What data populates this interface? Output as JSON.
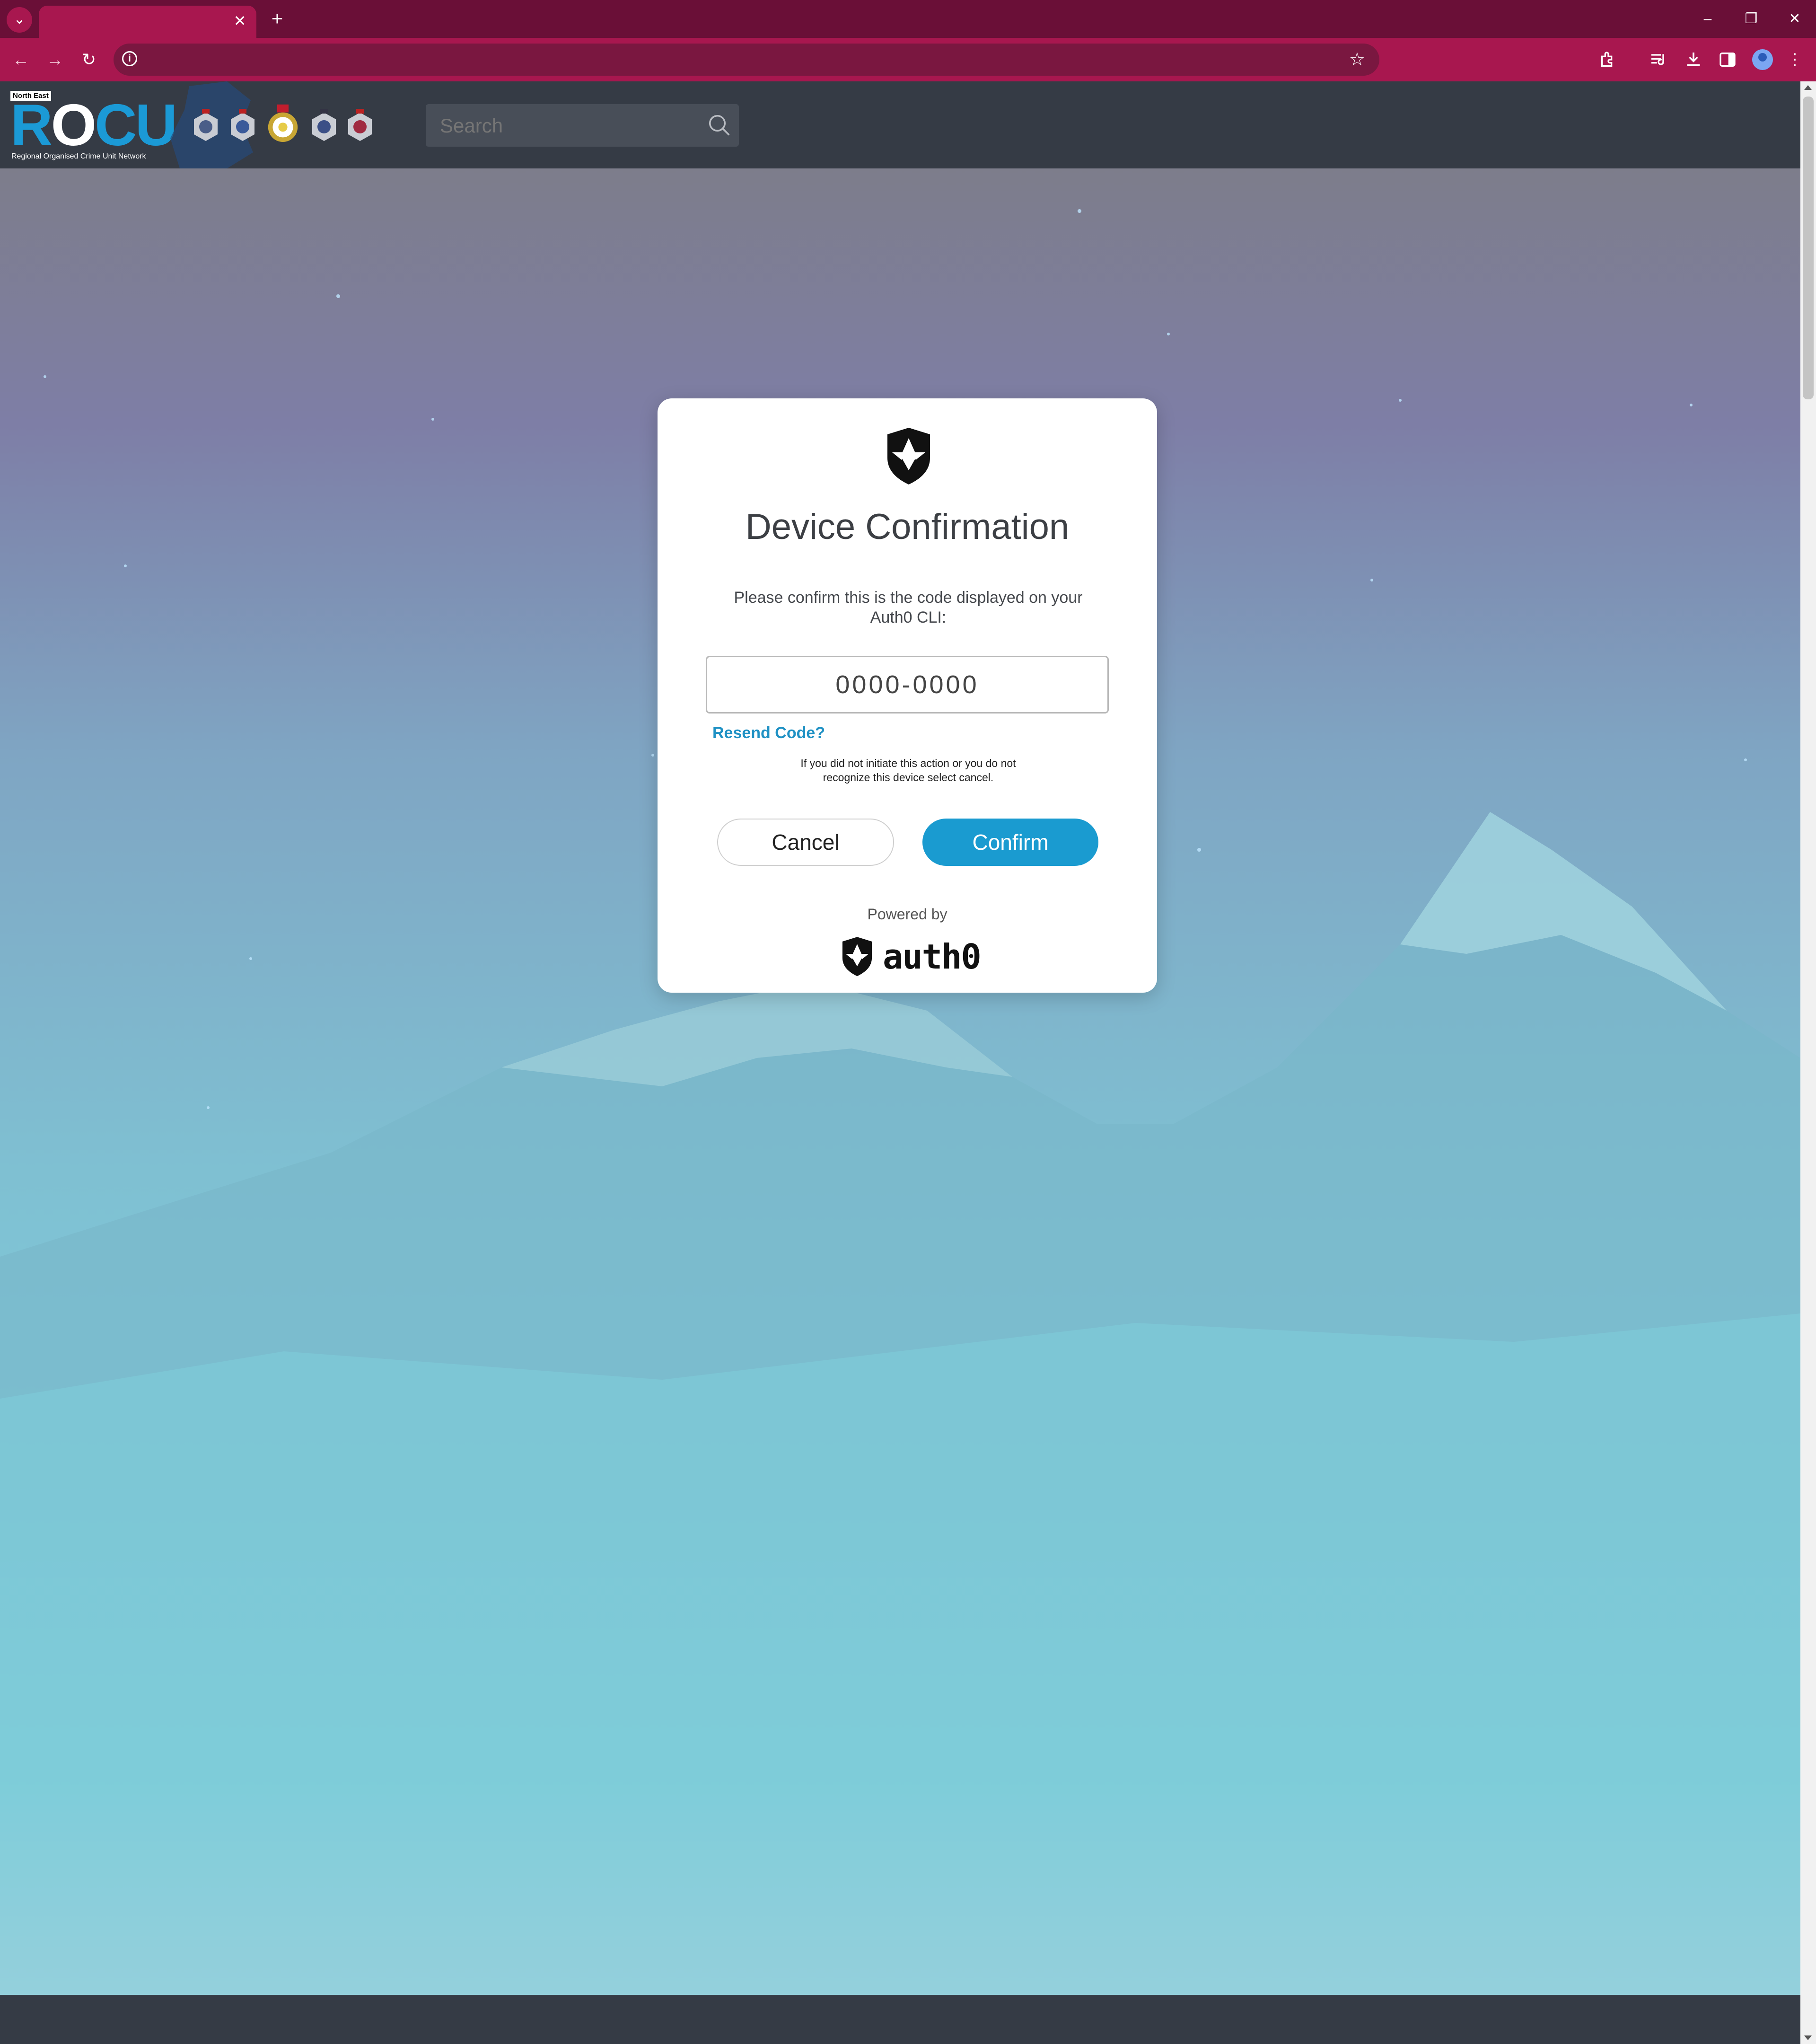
{
  "browser": {
    "tab_dropdown_icon": "chevron-down-icon",
    "tab_close_glyph": "✕",
    "new_tab_glyph": "+",
    "window_controls": {
      "minimize": "–",
      "restore": "❐",
      "close": "✕"
    },
    "nav": {
      "back": "←",
      "forward": "→",
      "reload": "↻"
    },
    "omnibox_info": "i",
    "bookmark_glyph": "☆"
  },
  "site": {
    "logo": {
      "tag": "North East",
      "word_part1": "R",
      "word_part2": "O",
      "word_part3": "CU",
      "subtitle": "Regional Organised Crime Unit Network"
    },
    "search": {
      "placeholder": "Search"
    }
  },
  "dialog": {
    "title": "Device Confirmation",
    "description": "Please confirm this is the code displayed on your Auth0 CLI:",
    "code": "0000-0000",
    "resend_label": "Resend Code?",
    "note": "If you did not initiate this action or you do not recognize this device select cancel.",
    "cancel_label": "Cancel",
    "confirm_label": "Confirm",
    "powered_by": "Powered by",
    "brand": "auth0"
  },
  "colors": {
    "chrome_dark": "#6a0f37",
    "chrome_accent": "#a8174f",
    "header_bg": "#353b45",
    "confirm_button": "#1a9bd0",
    "link": "#1f91c4"
  }
}
